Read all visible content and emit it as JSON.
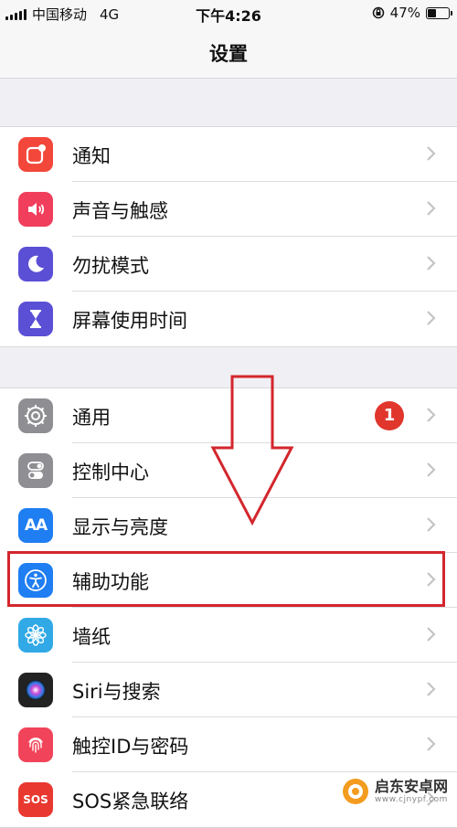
{
  "status_bar": {
    "carrier": "中国移动",
    "network": "4G",
    "time": "下午4:26",
    "battery": "47%",
    "battery_level": 0.47
  },
  "nav": {
    "title": "设置"
  },
  "groups": [
    {
      "items": [
        {
          "label": "通知",
          "icon": "notification-icon",
          "color": "#f2473a"
        },
        {
          "label": "声音与触感",
          "icon": "speaker-icon",
          "color": "#f03e5c"
        },
        {
          "label": "勿扰模式",
          "icon": "moon-icon",
          "color": "#5b4fd6"
        },
        {
          "label": "屏幕使用时间",
          "icon": "hourglass-icon",
          "color": "#5b4fd6"
        }
      ]
    },
    {
      "items": [
        {
          "label": "通用",
          "icon": "gear-icon",
          "color": "#8e8e93",
          "badge": "1"
        },
        {
          "label": "控制中心",
          "icon": "toggles-icon",
          "color": "#8e8e93"
        },
        {
          "label": "显示与亮度",
          "icon": "text-size-icon",
          "color": "#1f7ef2"
        },
        {
          "label": "辅助功能",
          "icon": "accessibility-icon",
          "color": "#1f7ef2"
        },
        {
          "label": "墙纸",
          "icon": "flower-icon",
          "color": "#31a9e6"
        },
        {
          "label": "Siri与搜索",
          "icon": "siri-icon",
          "color": "#222"
        },
        {
          "label": "触控ID与密码",
          "icon": "fingerprint-icon",
          "color": "#f1445a"
        },
        {
          "label": "SOS紧急联络",
          "icon": "sos-icon",
          "color": "#e8382f"
        }
      ]
    }
  ],
  "icon_text": {
    "text_size": "AA",
    "sos": "SOS"
  },
  "annotation": {
    "highlight_color": "#d3262c"
  },
  "watermark": {
    "text": "启东安卓网",
    "sub": "www.cjnypf.com"
  }
}
